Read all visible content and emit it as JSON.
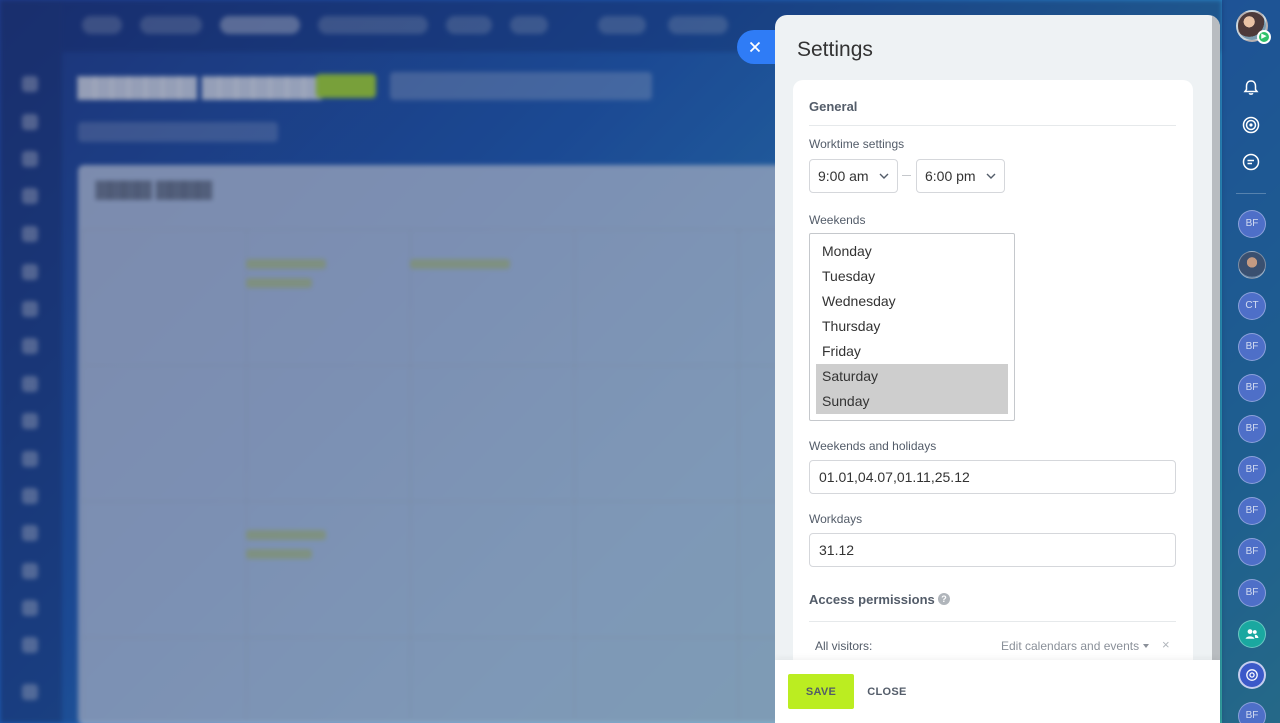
{
  "panel": {
    "title": "Settings"
  },
  "general": {
    "heading": "General",
    "worktime": {
      "label": "Worktime settings",
      "start": "9:00 am",
      "end": "6:00 pm"
    },
    "weekends": {
      "label": "Weekends",
      "options": [
        {
          "label": "Monday",
          "selected": false
        },
        {
          "label": "Tuesday",
          "selected": false
        },
        {
          "label": "Wednesday",
          "selected": false
        },
        {
          "label": "Thursday",
          "selected": false
        },
        {
          "label": "Friday",
          "selected": false
        },
        {
          "label": "Saturday",
          "selected": true
        },
        {
          "label": "Sunday",
          "selected": true
        }
      ]
    },
    "holidays": {
      "label": "Weekends and holidays",
      "value": "01.01,04.07,01.11,25.12"
    },
    "workdays": {
      "label": "Workdays",
      "value": "31.12"
    }
  },
  "access": {
    "heading": "Access permissions",
    "help": "?",
    "row": {
      "label": "All visitors:",
      "value": "Edit calendars and events",
      "remove": "×"
    }
  },
  "footer": {
    "save_label": "SAVE",
    "close_label": "CLOSE"
  },
  "right_rail": {
    "chips": [
      {
        "initials": "BF",
        "style": "default"
      },
      {
        "initials": "",
        "style": "photo"
      },
      {
        "initials": "CT",
        "style": "default"
      },
      {
        "initials": "BF",
        "style": "default"
      },
      {
        "initials": "BF",
        "style": "default"
      },
      {
        "initials": "BF",
        "style": "default"
      },
      {
        "initials": "BF",
        "style": "default"
      },
      {
        "initials": "BF",
        "style": "default"
      },
      {
        "initials": "BF",
        "style": "default"
      },
      {
        "initials": "BF",
        "style": "default"
      }
    ],
    "bottom_chip": "BF"
  },
  "colors": {
    "accent": "#2f7cf6",
    "save_button": "#bbed21",
    "selected_option": "#cecece"
  }
}
